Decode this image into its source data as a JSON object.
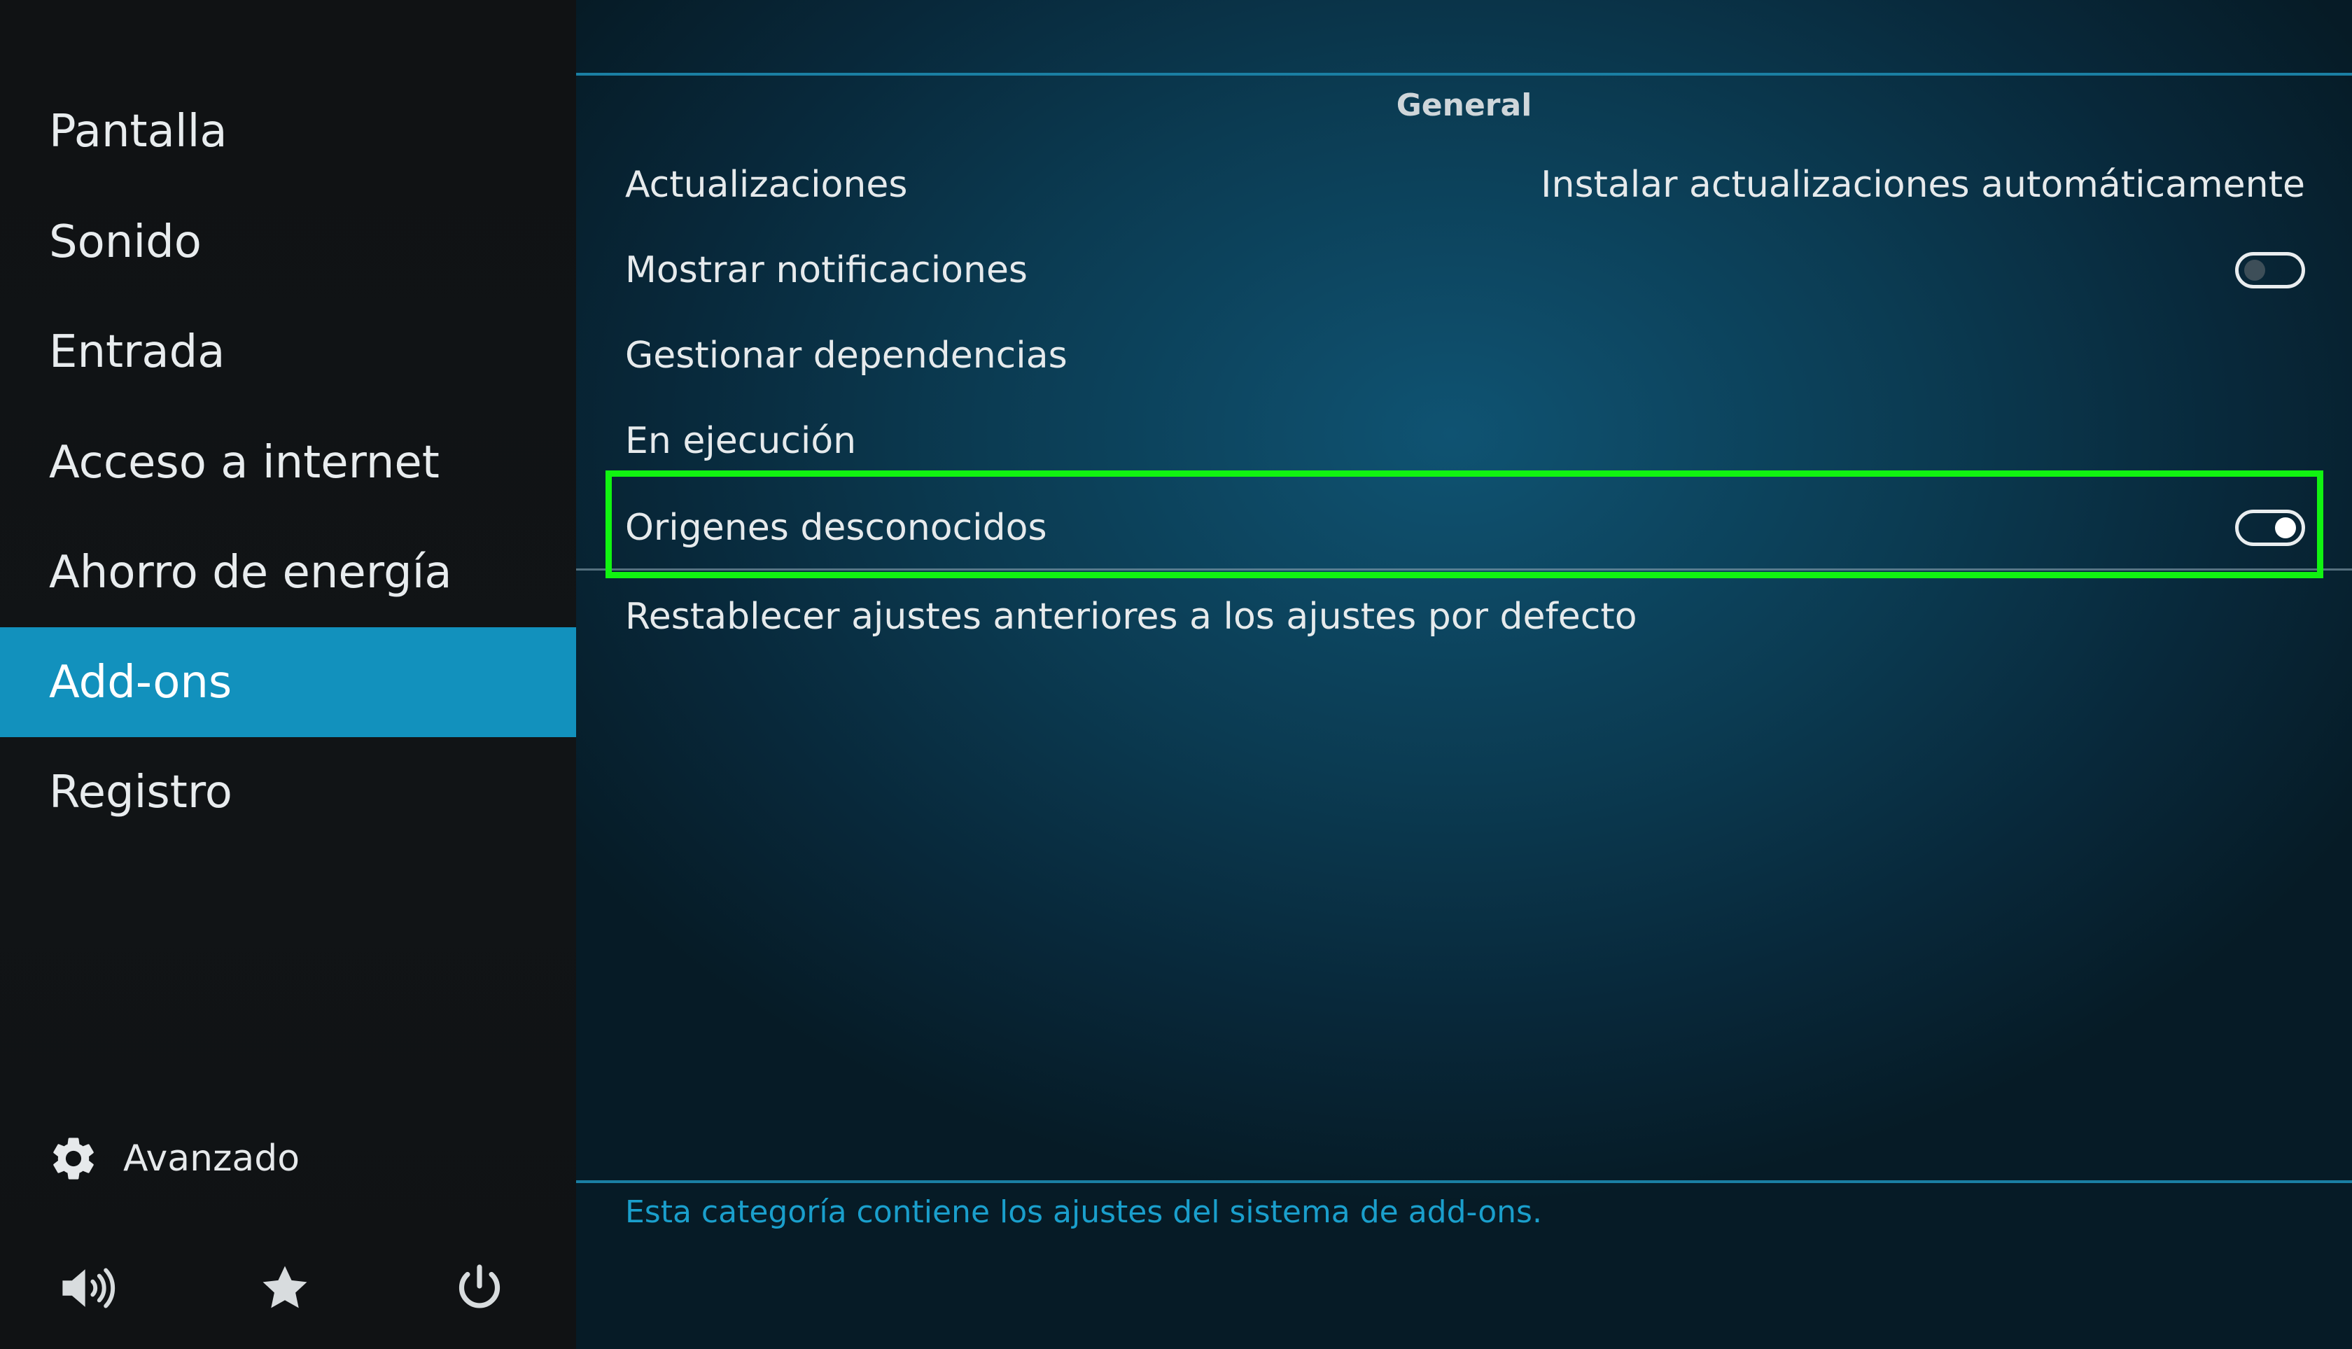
{
  "sidebar": {
    "items": [
      {
        "label": "Pantalla"
      },
      {
        "label": "Sonido"
      },
      {
        "label": "Entrada"
      },
      {
        "label": "Acceso a internet"
      },
      {
        "label": "Ahorro de energía"
      },
      {
        "label": "Add-ons",
        "active": true
      },
      {
        "label": "Registro"
      }
    ],
    "advanced_label": "Avanzado",
    "advanced_icon": "gear-icon",
    "bottom_icons": [
      "volume-icon",
      "star-icon",
      "power-icon"
    ]
  },
  "main": {
    "section_title": "General",
    "settings": [
      {
        "label": "Actualizaciones",
        "value": "Instalar actualizaciones automáticamente"
      },
      {
        "label": "Mostrar notificaciones",
        "toggle": false
      },
      {
        "label": "Gestionar dependencias"
      },
      {
        "label": "En ejecución"
      },
      {
        "label": "Origenes desconocidos",
        "toggle": true,
        "highlighted": true
      },
      {
        "label": "Restablecer ajustes anteriores a los ajustes por defecto"
      }
    ],
    "description": "Esta categoría contiene los ajustes del sistema de add-ons."
  },
  "colors": {
    "accent": "#1291bd",
    "highlight": "#11f311",
    "description_text": "#1a9fcc"
  }
}
